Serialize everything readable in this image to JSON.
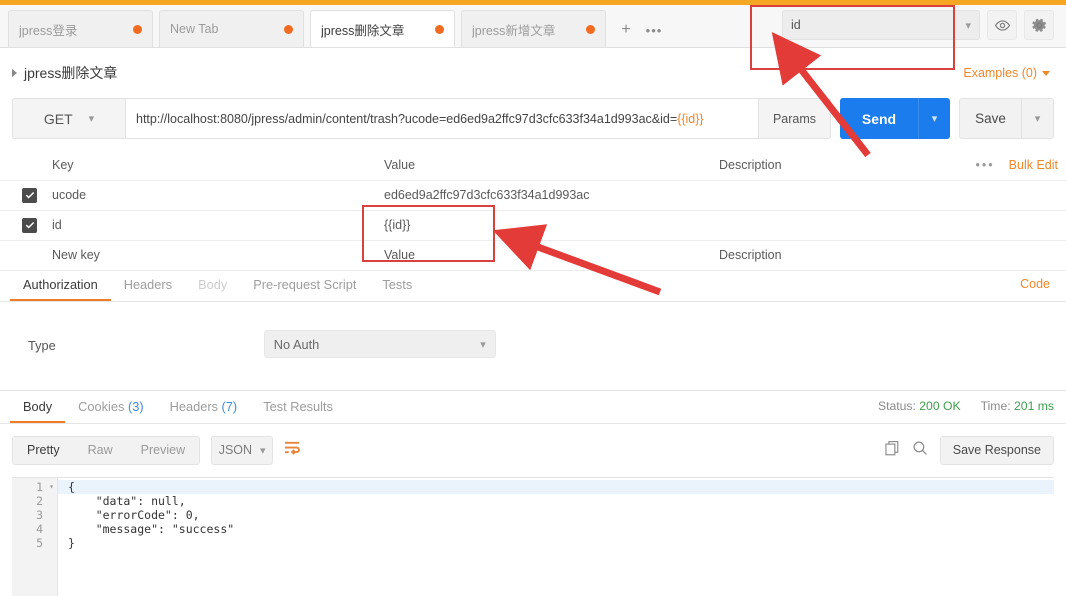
{
  "window": {
    "accent_top_color": "#f5a623"
  },
  "tabs": {
    "items": [
      {
        "label": "jpress登录",
        "active": false,
        "unsaved": true
      },
      {
        "label": "New Tab",
        "active": false,
        "unsaved": true
      },
      {
        "label": "jpress删除文章",
        "active": true,
        "unsaved": true
      },
      {
        "label": "jpress新增文章",
        "active": false,
        "unsaved": true
      }
    ],
    "add_label": "+",
    "more_label": "•••"
  },
  "environment": {
    "selected": "id",
    "eye_icon": "eye-icon",
    "gear_icon": "gear-icon"
  },
  "request": {
    "title": "jpress删除文章",
    "examples_label": "Examples (0)",
    "method": "GET",
    "url_prefix": "http://localhost:8080/jpress/admin/content/trash?ucode=ed6ed9a2ffc97d3cfc633f34a1d993ac&id=",
    "url_variable": "{{id}}",
    "params_label": "Params",
    "send_label": "Send",
    "save_label": "Save"
  },
  "params": {
    "headers": {
      "key": "Key",
      "value": "Value",
      "description": "Description",
      "bulk_edit": "Bulk Edit",
      "more": "•••"
    },
    "rows": [
      {
        "checked": true,
        "key": "ucode",
        "value": "ed6ed9a2ffc97d3cfc633f34a1d993ac",
        "description": "",
        "is_variable": false
      },
      {
        "checked": true,
        "key": "id",
        "value": "{{id}}",
        "description": "",
        "is_variable": true
      }
    ],
    "new_row": {
      "key_placeholder": "New key",
      "value_placeholder": "Value",
      "description_placeholder": "Description"
    }
  },
  "request_tabs": {
    "items": [
      {
        "label": "Authorization",
        "active": true,
        "dim": false
      },
      {
        "label": "Headers",
        "active": false,
        "dim": false
      },
      {
        "label": "Body",
        "active": false,
        "dim": true
      },
      {
        "label": "Pre-request Script",
        "active": false,
        "dim": false
      },
      {
        "label": "Tests",
        "active": false,
        "dim": false
      }
    ],
    "code_label": "Code"
  },
  "auth": {
    "type_label": "Type",
    "type_value": "No Auth"
  },
  "response": {
    "tabs": [
      {
        "label": "Body",
        "count": "",
        "active": true
      },
      {
        "label": "Cookies",
        "count": "(3)",
        "active": false
      },
      {
        "label": "Headers",
        "count": "(7)",
        "active": false
      },
      {
        "label": "Test Results",
        "count": "",
        "active": false
      }
    ],
    "status_label": "Status:",
    "status_value": "200 OK",
    "time_label": "Time:",
    "time_value": "201 ms",
    "view_modes": [
      {
        "label": "Pretty",
        "active": true
      },
      {
        "label": "Raw",
        "active": false
      },
      {
        "label": "Preview",
        "active": false
      }
    ],
    "format": "JSON",
    "wrap_icon": "wrap-lines-icon",
    "copy_icon": "copy-icon",
    "search_icon": "search-icon",
    "save_response_label": "Save Response",
    "body_lines": [
      {
        "num": "1",
        "text": "{"
      },
      {
        "num": "2",
        "text": "    \"data\": null,"
      },
      {
        "num": "3",
        "text": "    \"errorCode\": 0,"
      },
      {
        "num": "4",
        "text": "    \"message\": \"success\""
      },
      {
        "num": "5",
        "text": "}"
      }
    ]
  },
  "annotations": {
    "color": "#d9413f",
    "boxes": [
      {
        "name": "environment-highlight"
      },
      {
        "name": "id-value-highlight"
      }
    ],
    "arrows": [
      {
        "name": "arrow-to-environment"
      },
      {
        "name": "arrow-to-id-value"
      }
    ]
  }
}
